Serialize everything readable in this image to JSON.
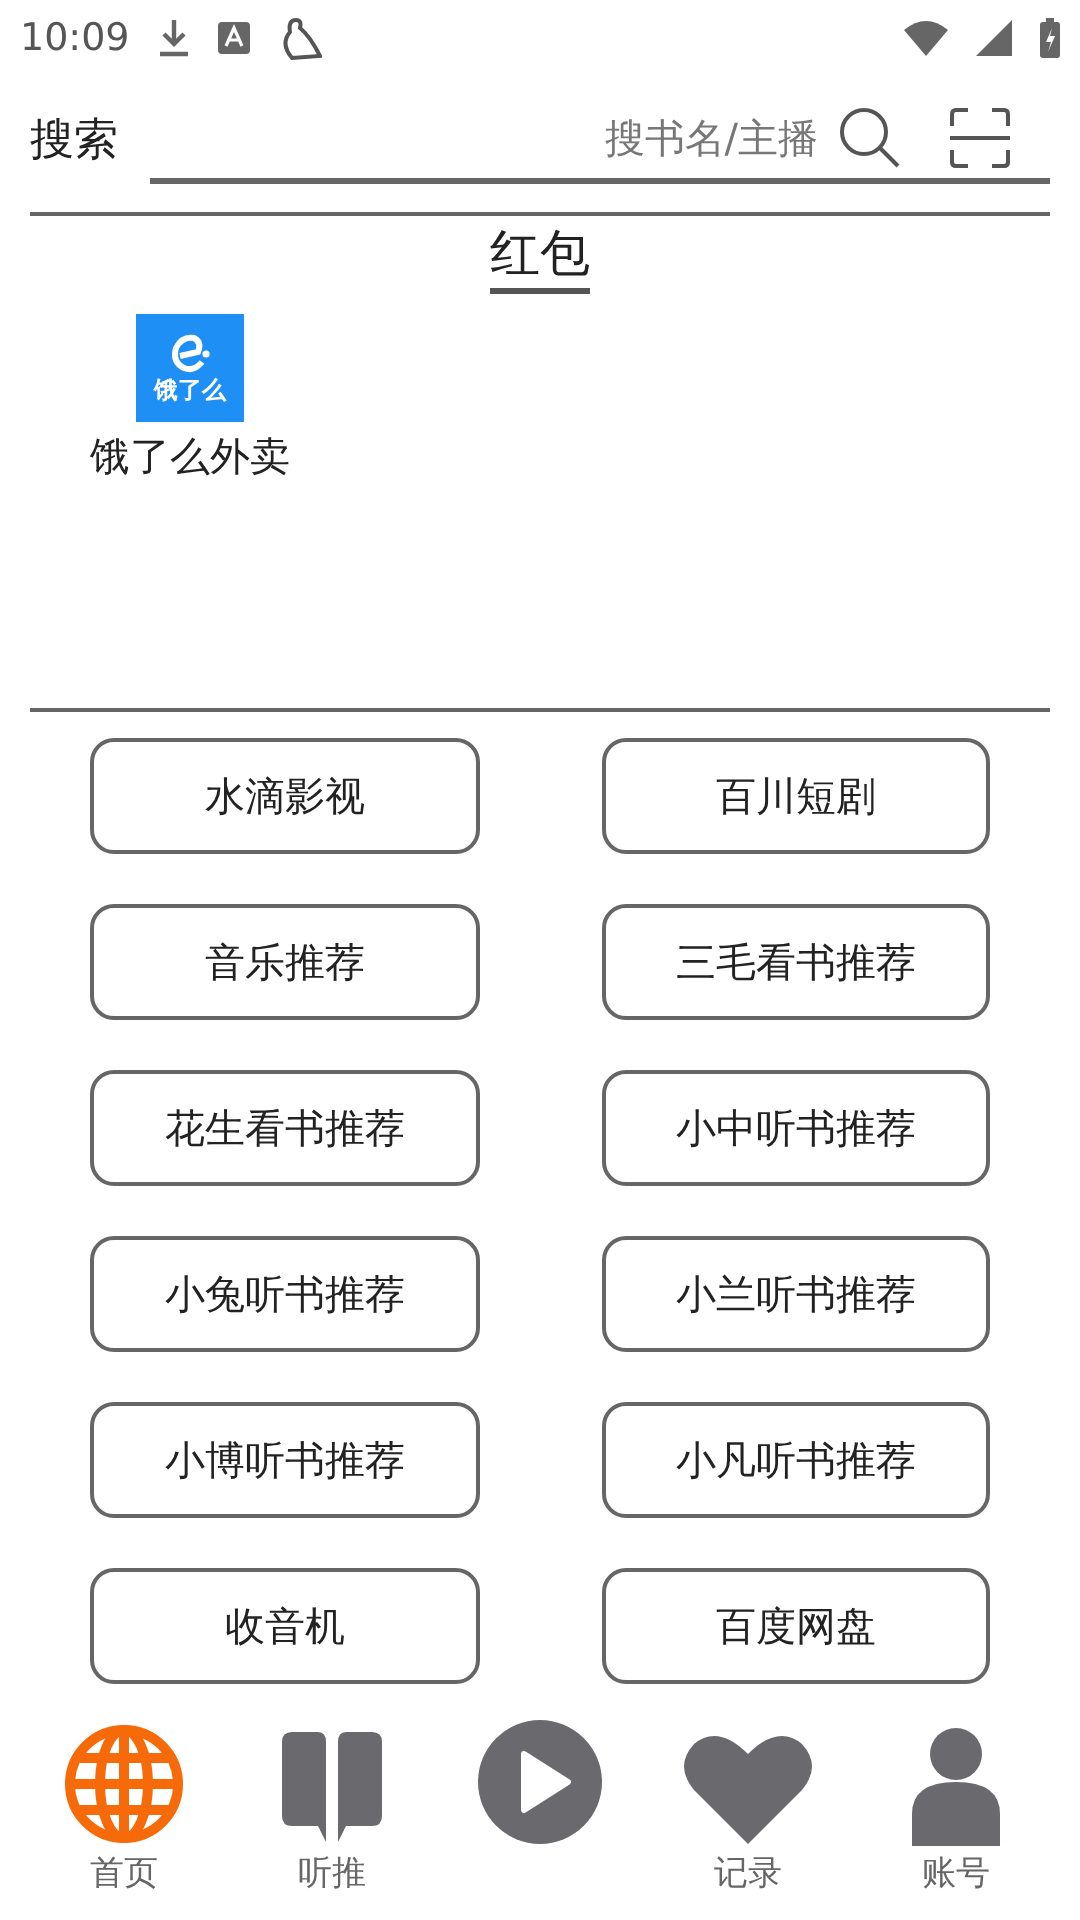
{
  "status_bar": {
    "time": "10:09"
  },
  "search": {
    "label": "搜索",
    "placeholder": "搜书名/主播"
  },
  "section": {
    "title": "红包",
    "apps": [
      {
        "logo_text": "饿了么",
        "label": "饿了么外卖"
      }
    ]
  },
  "links": [
    "水滴影视",
    "百川短剧",
    "音乐推荐",
    "三毛看书推荐",
    "花生看书推荐",
    "小中听书推荐",
    "小兔听书推荐",
    "小兰听书推荐",
    "小博听书推荐",
    "小凡听书推荐",
    "收音机",
    "百度网盘"
  ],
  "nav": [
    {
      "kind": "globe",
      "label": "首页",
      "selected": true
    },
    {
      "kind": "book",
      "label": "听推",
      "selected": false
    },
    {
      "kind": "play",
      "selected": false
    },
    {
      "kind": "heart",
      "label": "记录",
      "selected": false
    },
    {
      "kind": "person",
      "label": "账号",
      "selected": false
    }
  ]
}
